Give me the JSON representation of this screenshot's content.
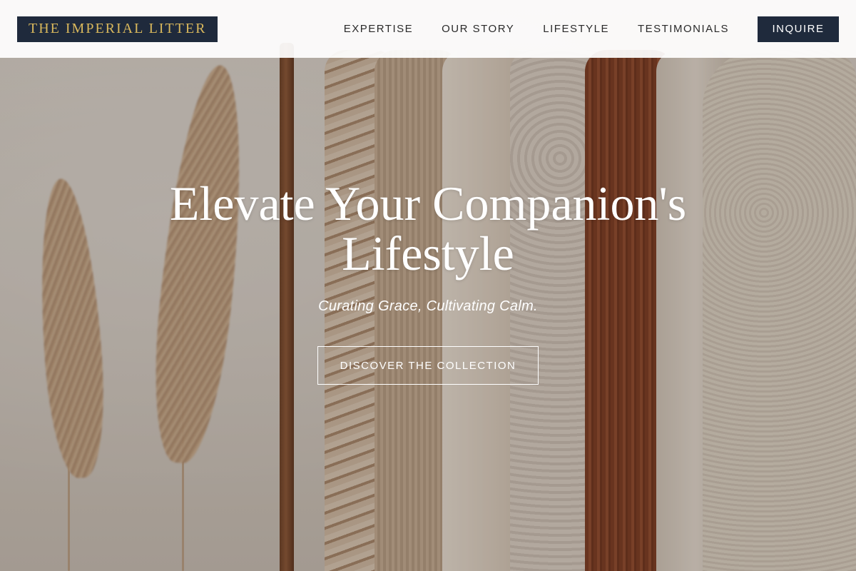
{
  "header": {
    "logo_text": "THE IMPERIAL LITTER",
    "nav": [
      {
        "label": "EXPERTISE"
      },
      {
        "label": "OUR STORY"
      },
      {
        "label": "LIFESTYLE"
      },
      {
        "label": "TESTIMONIALS"
      }
    ],
    "cta_label": "INQUIRE"
  },
  "hero": {
    "title": "Elevate Your Companion's Lifestyle",
    "tagline": "Curating Grace, Cultivating Calm.",
    "button_label": "DISCOVER THE COLLECTION"
  },
  "colors": {
    "navy": "#1f2a3c",
    "gold": "#d9b85c",
    "white": "#ffffff"
  }
}
